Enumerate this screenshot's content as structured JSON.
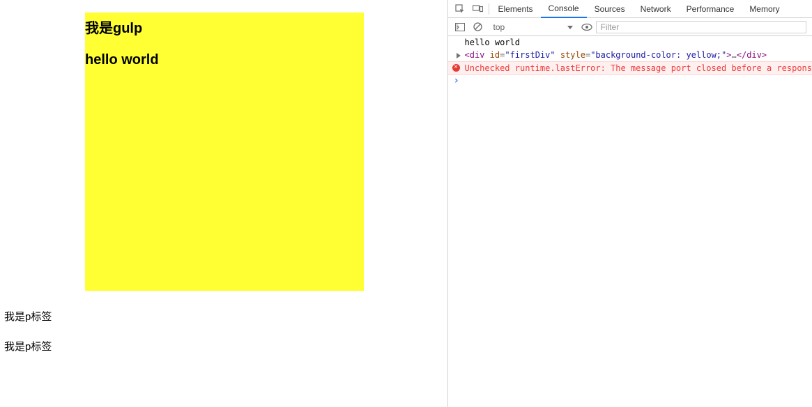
{
  "page": {
    "heading1": "我是gulp",
    "heading2": "hello world",
    "p1": "我是p标签",
    "p2": "我是p标签"
  },
  "devtools": {
    "tabs": {
      "elements": "Elements",
      "console": "Console",
      "sources": "Sources",
      "network": "Network",
      "performance": "Performance",
      "memory": "Memory"
    },
    "toolbar": {
      "context": "top",
      "filter_placeholder": "Filter"
    },
    "console": {
      "log1": "hello world",
      "element": {
        "open_angle": "<",
        "tag_open": "div",
        "attr_id_name": "id",
        "attr_id_val": "\"firstDiv\"",
        "attr_style_name": "style",
        "attr_style_val": "\"background-color: yellow;\"",
        "close_open": ">",
        "ellipsis": "…",
        "open_close": "</",
        "tag_close": "div",
        "close_close": ">"
      },
      "error": "Unchecked runtime.lastError: The message port closed before a respons"
    }
  }
}
